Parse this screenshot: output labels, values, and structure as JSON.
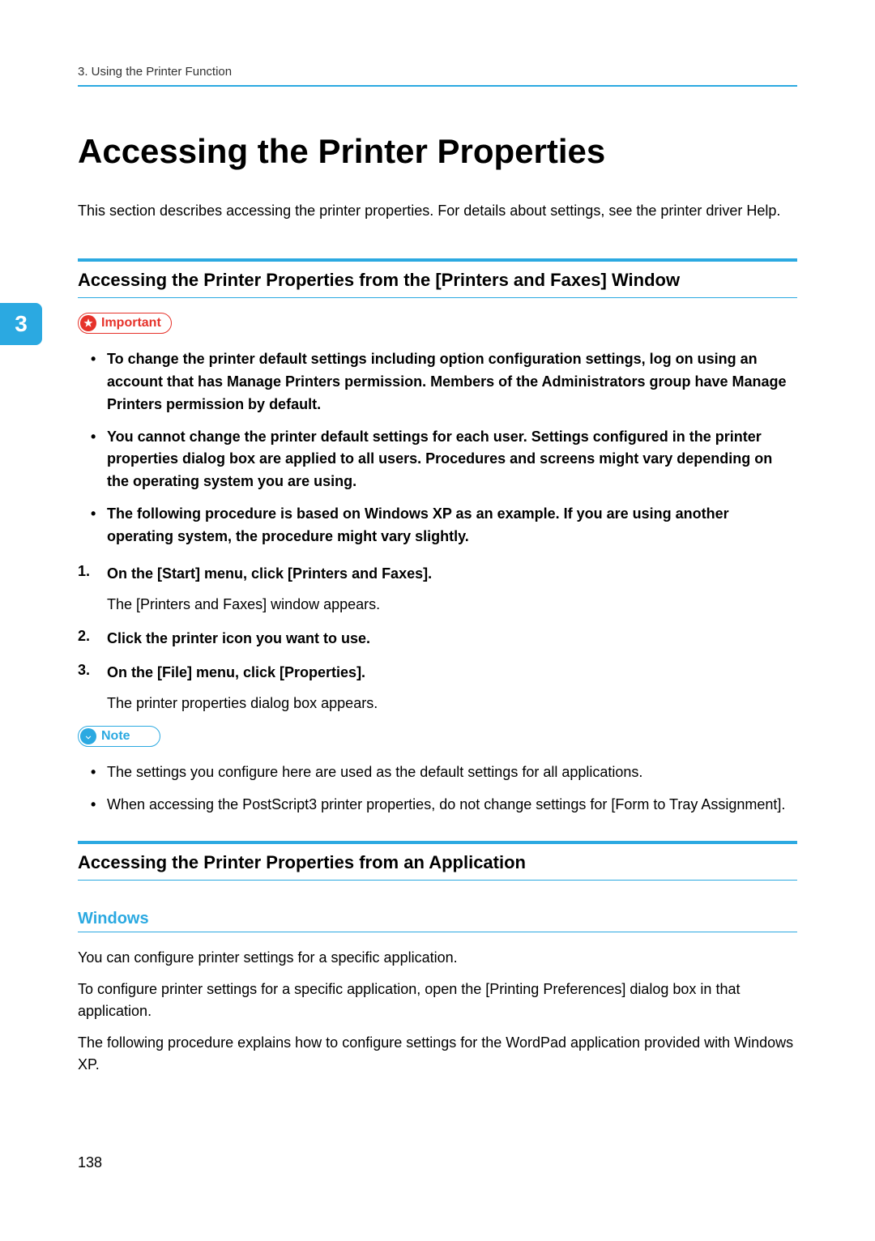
{
  "breadcrumb": "3. Using the Printer Function",
  "chapterNumber": "3",
  "title": "Accessing the Printer Properties",
  "intro": "This section describes accessing the printer properties. For details about settings, see the printer driver Help.",
  "section1": {
    "heading": "Accessing the Printer Properties from the [Printers and Faxes] Window",
    "importantLabel": "Important",
    "importantItems": [
      "To change the printer default settings including option configuration settings, log on using an account that has Manage Printers permission. Members of the Administrators group have Manage Printers permission by default.",
      "You cannot change the printer default settings for each user. Settings configured in the printer properties dialog box are applied to all users. Procedures and screens might vary depending on the operating system you are using.",
      "The following procedure is based on Windows XP as an example. If you are using another operating system, the procedure might vary slightly."
    ],
    "steps": [
      {
        "title": "On the [Start] menu, click [Printers and Faxes].",
        "desc": "The [Printers and Faxes] window appears."
      },
      {
        "title": "Click the printer icon you want to use.",
        "desc": ""
      },
      {
        "title": "On the [File] menu, click [Properties].",
        "desc": "The printer properties dialog box appears."
      }
    ],
    "noteLabel": "Note",
    "noteItems": [
      "The settings you configure here are used as the default settings for all applications.",
      "When accessing the PostScript3 printer properties, do not change settings for [Form to Tray Assignment]."
    ]
  },
  "section2": {
    "heading": "Accessing the Printer Properties from an Application",
    "subheading": "Windows",
    "paragraphs": [
      "You can configure printer settings for a specific application.",
      "To configure printer settings for a specific application, open the [Printing Preferences] dialog box in that application.",
      "The following procedure explains how to configure settings for the WordPad application provided with Windows XP."
    ]
  },
  "pageNumber": "138"
}
